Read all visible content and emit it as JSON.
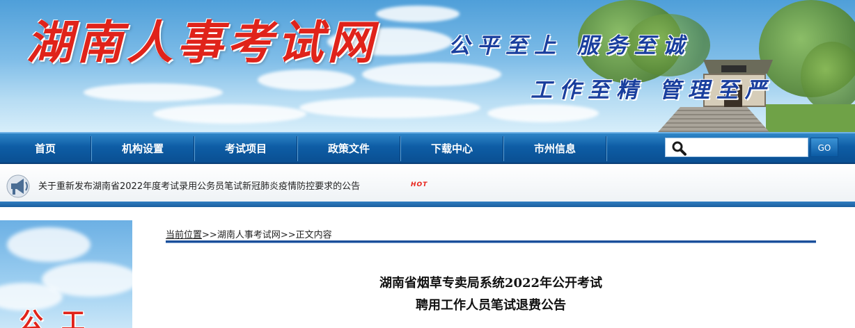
{
  "banner": {
    "site_title": "湖南人事考试网",
    "slogan_1": "公平至上 服务至诚",
    "slogan_2": "工作至精 管理至严"
  },
  "nav": {
    "items": [
      {
        "label": "首页"
      },
      {
        "label": "机构设置"
      },
      {
        "label": "考试项目"
      },
      {
        "label": "政策文件"
      },
      {
        "label": "下载中心"
      },
      {
        "label": "市州信息"
      }
    ],
    "search_placeholder": "",
    "search_button": "GO"
  },
  "notice": {
    "text": "关于重新发布湖南省2022年度考试录用公务员笔试新冠肺炎疫情防控要求的公告",
    "badge": "HOT"
  },
  "left_panel": {
    "slogan": "公工"
  },
  "breadcrumb": {
    "current_label": "当前位置",
    "sep1": ">>",
    "site": "湖南人事考试网",
    "sep2": ">>",
    "page": "正文内容"
  },
  "article": {
    "title_line_1": "湖南省烟草专卖局系统2022年公开考试",
    "title_line_2": "聘用工作人员笔试退费公告"
  },
  "colors": {
    "nav_blue": "#0e5da5",
    "title_red": "#e0231a",
    "slogan_blue": "#1a3f9e"
  }
}
